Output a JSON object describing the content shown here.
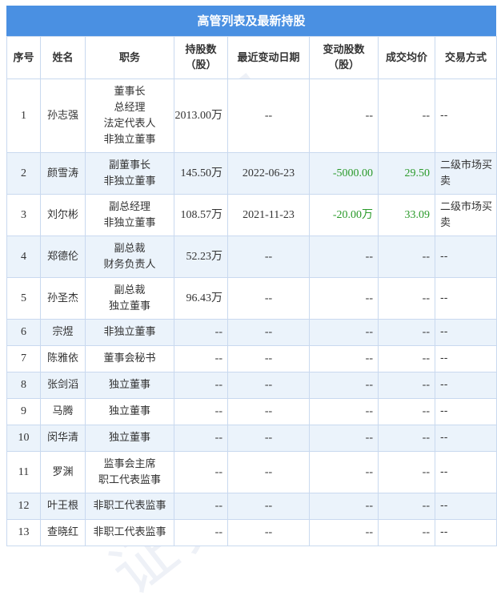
{
  "title": "高管列表及最新持股",
  "columns": {
    "seq": "序号",
    "name": "姓名",
    "position": "职务",
    "holding_line1": "持股数",
    "holding_line2": "（股）",
    "date": "最近变动日期",
    "change_line1": "变动股数",
    "change_line2": "（股）",
    "price": "成交均价",
    "method": "交易方式"
  },
  "rows": [
    {
      "seq": "1",
      "name": "孙志强",
      "position": [
        "董事长",
        "总经理",
        "法定代表人",
        "非独立董事"
      ],
      "holding": "2013.00万",
      "date": "--",
      "change": "--",
      "price": "--",
      "method": "--"
    },
    {
      "seq": "2",
      "name": "颜雪涛",
      "position": [
        "副董事长",
        "非独立董事"
      ],
      "holding": "145.50万",
      "date": "2022-06-23",
      "change": "-5000.00",
      "price": "29.50",
      "method": "二级市场买卖"
    },
    {
      "seq": "3",
      "name": "刘尔彬",
      "position": [
        "副总经理",
        "非独立董事"
      ],
      "holding": "108.57万",
      "date": "2021-11-23",
      "change": "-20.00万",
      "price": "33.09",
      "method": "二级市场买卖"
    },
    {
      "seq": "4",
      "name": "郑德伦",
      "position": [
        "副总裁",
        "财务负责人"
      ],
      "holding": "52.23万",
      "date": "--",
      "change": "--",
      "price": "--",
      "method": "--"
    },
    {
      "seq": "5",
      "name": "孙圣杰",
      "position": [
        "副总裁",
        "独立董事"
      ],
      "holding": "96.43万",
      "date": "--",
      "change": "--",
      "price": "--",
      "method": "--"
    },
    {
      "seq": "6",
      "name": "宗煜",
      "position": [
        "非独立董事"
      ],
      "holding": "--",
      "date": "--",
      "change": "--",
      "price": "--",
      "method": "--"
    },
    {
      "seq": "7",
      "name": "陈雅依",
      "position": [
        "董事会秘书"
      ],
      "holding": "--",
      "date": "--",
      "change": "--",
      "price": "--",
      "method": "--"
    },
    {
      "seq": "8",
      "name": "张剑滔",
      "position": [
        "独立董事"
      ],
      "holding": "--",
      "date": "--",
      "change": "--",
      "price": "--",
      "method": "--"
    },
    {
      "seq": "9",
      "name": "马腾",
      "position": [
        "独立董事"
      ],
      "holding": "--",
      "date": "--",
      "change": "--",
      "price": "--",
      "method": "--"
    },
    {
      "seq": "10",
      "name": "闵华清",
      "position": [
        "独立董事"
      ],
      "holding": "--",
      "date": "--",
      "change": "--",
      "price": "--",
      "method": "--"
    },
    {
      "seq": "11",
      "name": "罗渊",
      "position": [
        "监事会主席",
        "职工代表监事"
      ],
      "holding": "--",
      "date": "--",
      "change": "--",
      "price": "--",
      "method": "--"
    },
    {
      "seq": "12",
      "name": "叶王根",
      "position": [
        "非职工代表监事"
      ],
      "holding": "--",
      "date": "--",
      "change": "--",
      "price": "--",
      "method": "--"
    },
    {
      "seq": "13",
      "name": "查晓红",
      "position": [
        "非职工代表监事"
      ],
      "holding": "--",
      "date": "--",
      "change": "--",
      "price": "--",
      "method": "--"
    }
  ],
  "watermark": "证券之星",
  "colors": {
    "header_bg": "#4a90e2",
    "row_alt_bg": "#ebf3fb",
    "border": "#c9d9ef",
    "value_green": "#2a9a2a"
  }
}
